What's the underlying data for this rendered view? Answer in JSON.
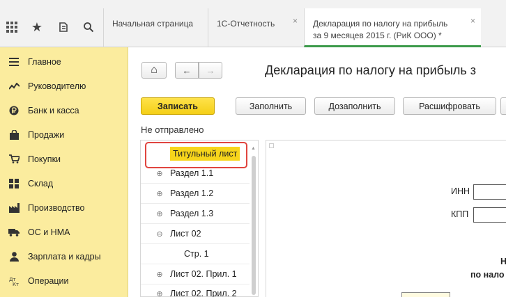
{
  "topbar": {
    "icons": [
      "apps-grid-icon",
      "star-icon",
      "history-icon",
      "search-icon"
    ],
    "tabs": [
      {
        "label": "Начальная страница",
        "active": false,
        "closable": false
      },
      {
        "label": "1С-Отчетность",
        "active": false,
        "closable": true
      },
      {
        "line1": "Декларация по налогу на прибыль",
        "line2": "за 9 месяцев 2015 г.  (РиК ООО) *",
        "active": true,
        "closable": true
      }
    ],
    "close_glyph": "×"
  },
  "sidebar": {
    "items": [
      {
        "label": "Главное",
        "icon": "menu-lines-icon"
      },
      {
        "label": "Руководителю",
        "icon": "trend-icon"
      },
      {
        "label": "Банк и касса",
        "icon": "ruble-coin-icon"
      },
      {
        "label": "Продажи",
        "icon": "shopping-bag-icon"
      },
      {
        "label": "Покупки",
        "icon": "cart-icon"
      },
      {
        "label": "Склад",
        "icon": "warehouse-grid-icon"
      },
      {
        "label": "Производство",
        "icon": "factory-icon"
      },
      {
        "label": "ОС и НМА",
        "icon": "truck-icon"
      },
      {
        "label": "Зарплата и кадры",
        "icon": "person-icon"
      },
      {
        "label": "Операции",
        "icon": "debit-credit-icon"
      }
    ]
  },
  "main": {
    "home_glyph": "⌂",
    "back_glyph": "←",
    "forward_glyph": "→",
    "title": "Декларация по налогу на прибыль з",
    "buttons": {
      "save": "Записать",
      "fill": "Заполнить",
      "refill": "Дозаполнить",
      "decode": "Расшифровать"
    },
    "status": "Не отправлено",
    "tree": [
      {
        "label": "Титульный лист",
        "toggle": "",
        "selected": true,
        "indent": 0
      },
      {
        "label": "Раздел 1.1",
        "toggle": "⊕",
        "selected": false,
        "indent": 0
      },
      {
        "label": "Раздел 1.2",
        "toggle": "⊕",
        "selected": false,
        "indent": 0
      },
      {
        "label": "Раздел 1.3",
        "toggle": "⊕",
        "selected": false,
        "indent": 0
      },
      {
        "label": "Лист 02",
        "toggle": "⊖",
        "selected": false,
        "indent": 0
      },
      {
        "label": "Стр. 1",
        "toggle": "",
        "selected": false,
        "indent": 1
      },
      {
        "label": "Лист 02. Прил. 1",
        "toggle": "⊕",
        "selected": false,
        "indent": 0
      },
      {
        "label": "Лист 02. Прил. 2",
        "toggle": "⊕",
        "selected": false,
        "indent": 0
      }
    ],
    "preview": {
      "inn_label": "ИНН",
      "kpp_label": "КПП",
      "frag1": "Н",
      "frag2": "по нало"
    }
  },
  "colors": {
    "sidebar_bg": "#fbec9e",
    "primary_button": "#f4cf17",
    "active_tab_underline": "#3c9a4a",
    "highlight_frame": "#e0453f"
  }
}
